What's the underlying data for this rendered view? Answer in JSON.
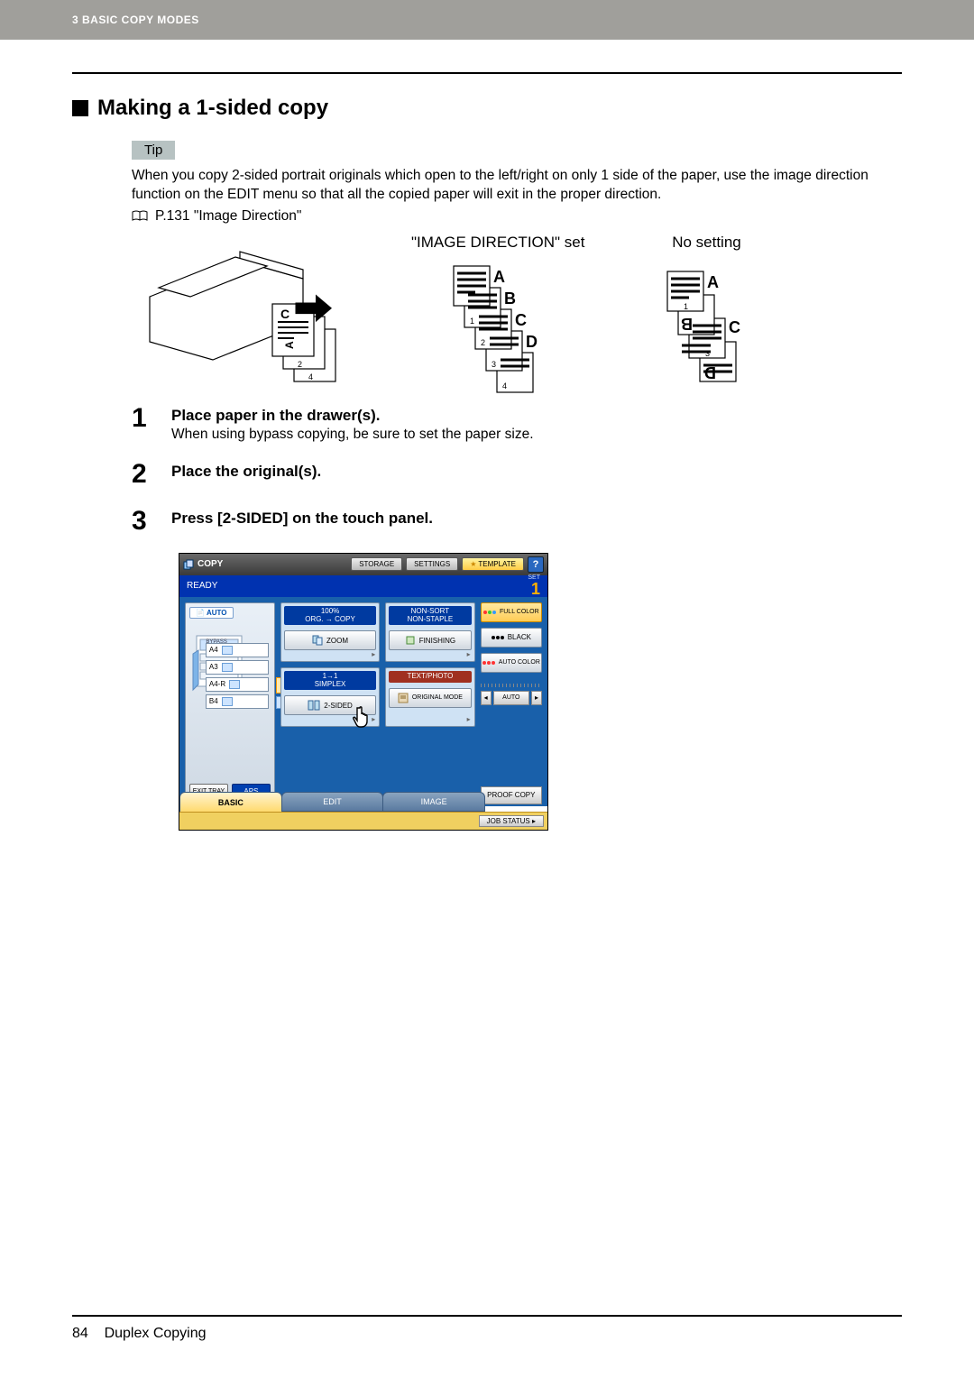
{
  "header": {
    "chapter": "3 BASIC COPY MODES"
  },
  "section_title": "Making a 1-sided copy",
  "tip": {
    "label": "Tip",
    "body": "When you copy 2-sided portrait originals which open to the left/right on only 1 side of the paper, use the image direction function on the EDIT menu so that all the copied paper will exit in the proper direction.",
    "ref": "P.131 \"Image Direction\""
  },
  "diagram": {
    "left_label": "\"IMAGE DIRECTION\" set",
    "right_label": "No setting",
    "letters": [
      "A",
      "B",
      "C",
      "D"
    ],
    "nums": [
      "1",
      "2",
      "3",
      "4"
    ]
  },
  "steps": [
    {
      "num": "1",
      "title": "Place paper in the drawer(s).",
      "sub": "When using bypass copying, be sure to set the paper size."
    },
    {
      "num": "2",
      "title": "Place the original(s).",
      "sub": ""
    },
    {
      "num": "3",
      "title": "Press [2-SIDED] on the touch panel.",
      "sub": ""
    }
  ],
  "panel": {
    "title": "COPY",
    "top_buttons": {
      "storage": "STORAGE",
      "settings": "SETTINGS",
      "template": "TEMPLATE",
      "help": "?"
    },
    "ready": "READY",
    "set_label": "SET",
    "set_count": "1",
    "auto": "AUTO",
    "bypass": "BYPASS FEED",
    "drawers": [
      "A4",
      "A3",
      "A4-R",
      "B4"
    ],
    "selected_drawer": "A4",
    "exit_tray": "EXIT TRAY",
    "aps": "APS",
    "zoom_head1": "100%",
    "zoom_head2": "ORG. → COPY",
    "zoom_btn": "ZOOM",
    "simplex_head1": "1→1",
    "simplex_head2": "SIMPLEX",
    "twosided_btn": "2-SIDED",
    "finish_head1": "NON-SORT",
    "finish_head2": "NON-STAPLE",
    "finish_btn": "FINISHING",
    "mode_head": "TEXT/PHOTO",
    "mode_btn": "ORIGINAL MODE",
    "color_full": "FULL COLOR",
    "color_black": "BLACK",
    "color_auto": "AUTO COLOR",
    "slider_auto": "AUTO",
    "proof": "PROOF COPY",
    "tabs": {
      "basic": "BASIC",
      "edit": "EDIT",
      "image": "IMAGE"
    },
    "job_status": "JOB STATUS"
  },
  "footer": {
    "page": "84",
    "title": "Duplex Copying"
  }
}
